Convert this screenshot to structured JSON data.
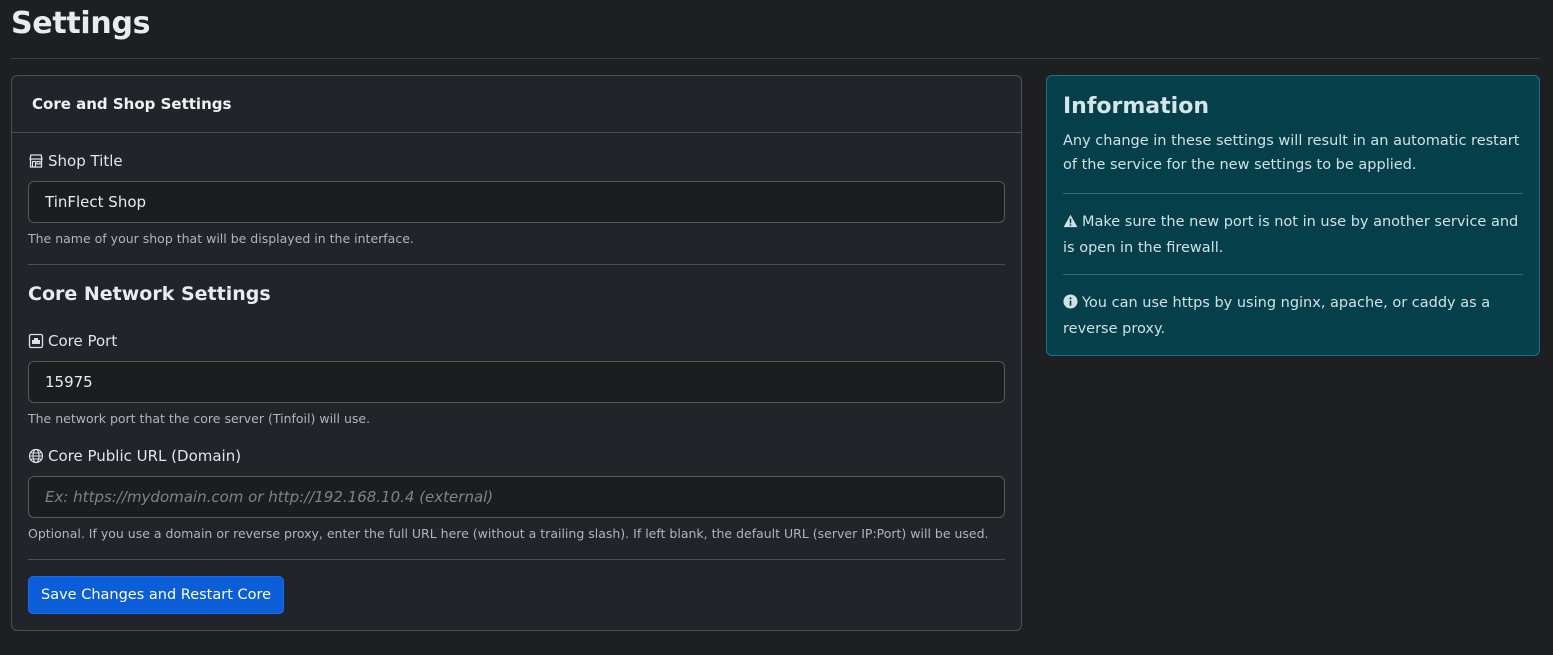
{
  "page": {
    "title": "Settings"
  },
  "card": {
    "header": "Core and Shop Settings",
    "shop_title": {
      "icon": "shop-icon",
      "label": "Shop Title",
      "value": "TinFlect Shop",
      "help": "The name of your shop that will be displayed in the interface."
    },
    "network_section": "Core Network Settings",
    "core_port": {
      "icon": "ethernet-icon",
      "label": "Core Port",
      "value": "15975",
      "help": "The network port that the core server (Tinfoil) will use."
    },
    "core_url": {
      "icon": "globe-icon",
      "label": "Core Public URL (Domain)",
      "value": "",
      "placeholder": "Ex: https://mydomain.com or http://192.168.10.4 (external)",
      "help": "Optional. If you use a domain or reverse proxy, enter the full URL here (without a trailing slash). If left blank, the default URL (server IP:Port) will be used."
    },
    "save_button": "Save Changes and Restart Core"
  },
  "info": {
    "title": "Information",
    "restart_notice": "Any change in these settings will result in an automatic restart of the service for the new settings to be applied.",
    "port_warning": "Make sure the new port is not in use by another service and is open in the firewall.",
    "https_tip": "You can use https by using nginx, apache, or caddy as a reverse proxy."
  },
  "colors": {
    "background": "#1e1f21",
    "card": "#212529",
    "primary_button": "#0b5ed7",
    "info_background": "#053f4a"
  }
}
